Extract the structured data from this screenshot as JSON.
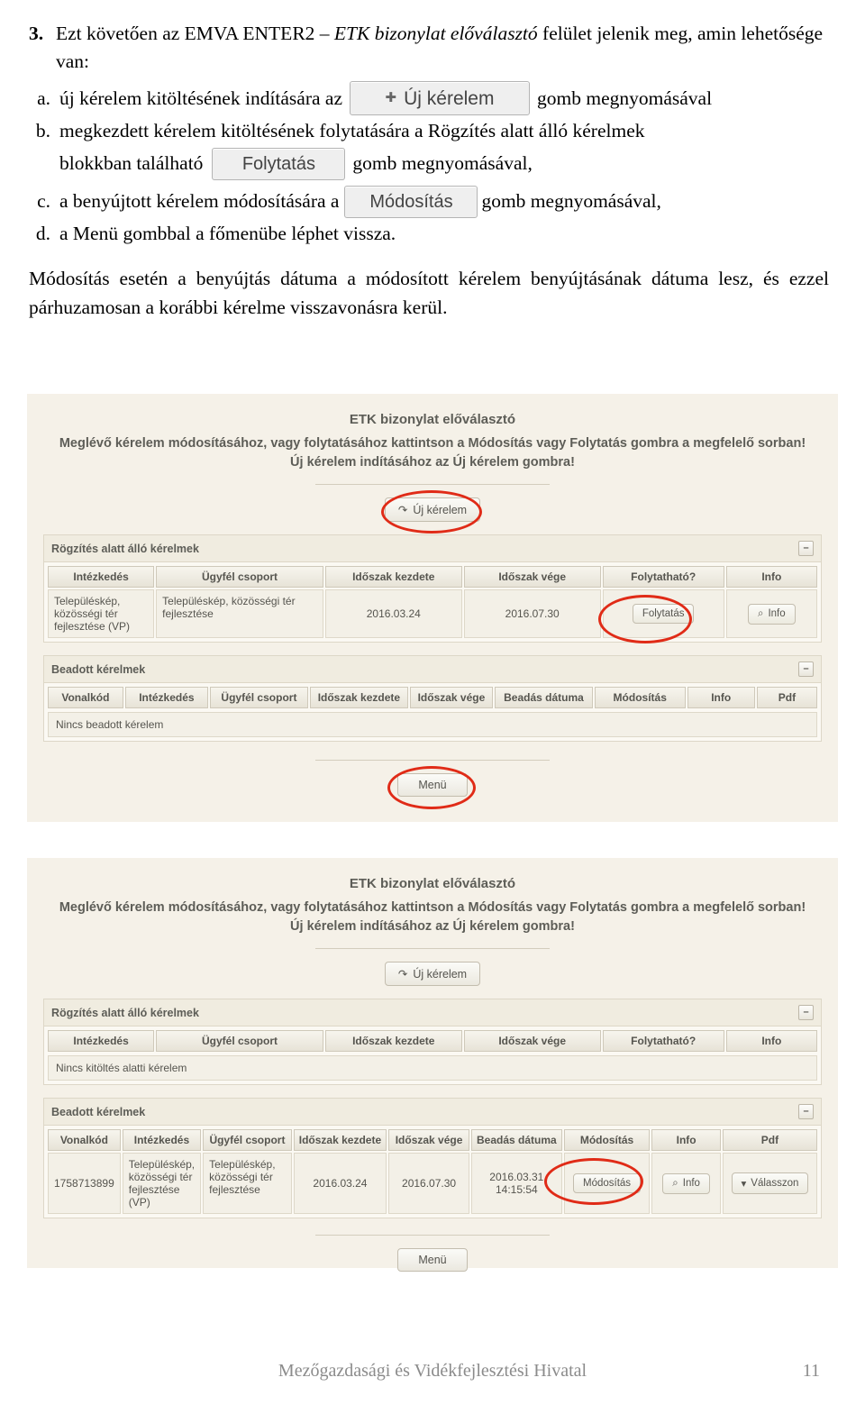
{
  "document": {
    "item_number": "3.",
    "intro_pre": "Ezt követően az EMVA ENTER2 – ",
    "intro_italic": "ETK bizonylat előválasztó",
    "intro_post": " felület jelenik meg, amin lehetősége van:",
    "list": [
      {
        "mark": "a.",
        "text_before": "új kérelem kitöltésének indítására az",
        "button": "Új kérelem",
        "text_after": "gomb megnyomásával"
      },
      {
        "mark": "b.",
        "line1": "megkezdett kérelem kitöltésének folytatására a Rögzítés alatt álló kérelmek",
        "text_before": "blokkban található",
        "button": "Folytatás",
        "text_after": "gomb megnyomásával,"
      },
      {
        "mark": "c.",
        "text_before": "a benyújtott kérelem módosítására a",
        "button": "Módosítás",
        "text_after": "gomb megnyomásával,"
      },
      {
        "mark": "d.",
        "text_before": "a Menü gombbal a főmenübe léphet vissza.",
        "button": "",
        "text_after": ""
      }
    ],
    "paragraph": "Módosítás esetén a benyújtás dátuma a módosított kérelem benyújtásának dátuma lesz, és ezzel párhuzamosan a korábbi kérelme visszavonásra kerül."
  },
  "screenshot1": {
    "title": "ETK bizonylat előválasztó",
    "sub1": "Meglévő kérelem módosításához, vagy folytatásához kattintson a Módosítás vagy Folytatás gombra a megfelelő sorban!",
    "sub2": "Új kérelem indításához az Új kérelem gombra!",
    "new_button": "Új kérelem",
    "panel1": {
      "title": "Rögzítés alatt álló kérelmek",
      "collapse": "–",
      "headers": [
        "Intézkedés",
        "Ügyfél csoport",
        "Időszak kezdete",
        "Időszak vége",
        "Folytatható?",
        "Info"
      ],
      "row": {
        "intezkedes": "Településkép, közösségi tér fejlesztése (VP)",
        "ugyfel_csoport": "Településkép, közösségi tér fejlesztése",
        "idoszak_kezdete": "2016.03.24",
        "idoszak_vege": "2016.07.30",
        "folytathato": "Folytatás",
        "info": "Info"
      }
    },
    "panel2": {
      "title": "Beadott kérelmek",
      "collapse": "–",
      "headers": [
        "Vonalkód",
        "Intézkedés",
        "Ügyfél csoport",
        "Időszak kezdete",
        "Időszak vége",
        "Beadás dátuma",
        "Módosítás",
        "Info",
        "Pdf"
      ],
      "empty_text": "Nincs beadott kérelem"
    },
    "menu_button": "Menü"
  },
  "screenshot2": {
    "title": "ETK bizonylat előválasztó",
    "sub1": "Meglévő kérelem módosításához, vagy folytatásához kattintson a Módosítás vagy Folytatás gombra a megfelelő sorban!",
    "sub2": "Új kérelem indításához az Új kérelem gombra!",
    "new_button": "Új kérelem",
    "panel1": {
      "title": "Rögzítés alatt álló kérelmek",
      "collapse": "–",
      "headers": [
        "Intézkedés",
        "Ügyfél csoport",
        "Időszak kezdete",
        "Időszak vége",
        "Folytatható?",
        "Info"
      ],
      "empty_text": "Nincs kitöltés alatti kérelem"
    },
    "panel2": {
      "title": "Beadott kérelmek",
      "collapse": "–",
      "headers": [
        "Vonalkód",
        "Intézkedés",
        "Ügyfél csoport",
        "Időszak kezdete",
        "Időszak vége",
        "Beadás dátuma",
        "Módosítás",
        "Info",
        "Pdf"
      ],
      "row": {
        "vonalkod": "1758713899",
        "intezkedes": "Településkép, közösségi tér fejlesztése (VP)",
        "ugyfel_csoport": "Településkép, közösségi tér fejlesztése",
        "idoszak_kezdete": "2016.03.24",
        "idoszak_vege": "2016.07.30",
        "beadas_datuma": "2016.03.31 14:15:54",
        "modositas": "Módosítás",
        "info": "Info",
        "pdf": "Válasszon"
      }
    },
    "menu_button": "Menü"
  },
  "footer": {
    "text": "Mezőgazdasági és Vidékfejlesztési Hivatal",
    "page": "11"
  }
}
